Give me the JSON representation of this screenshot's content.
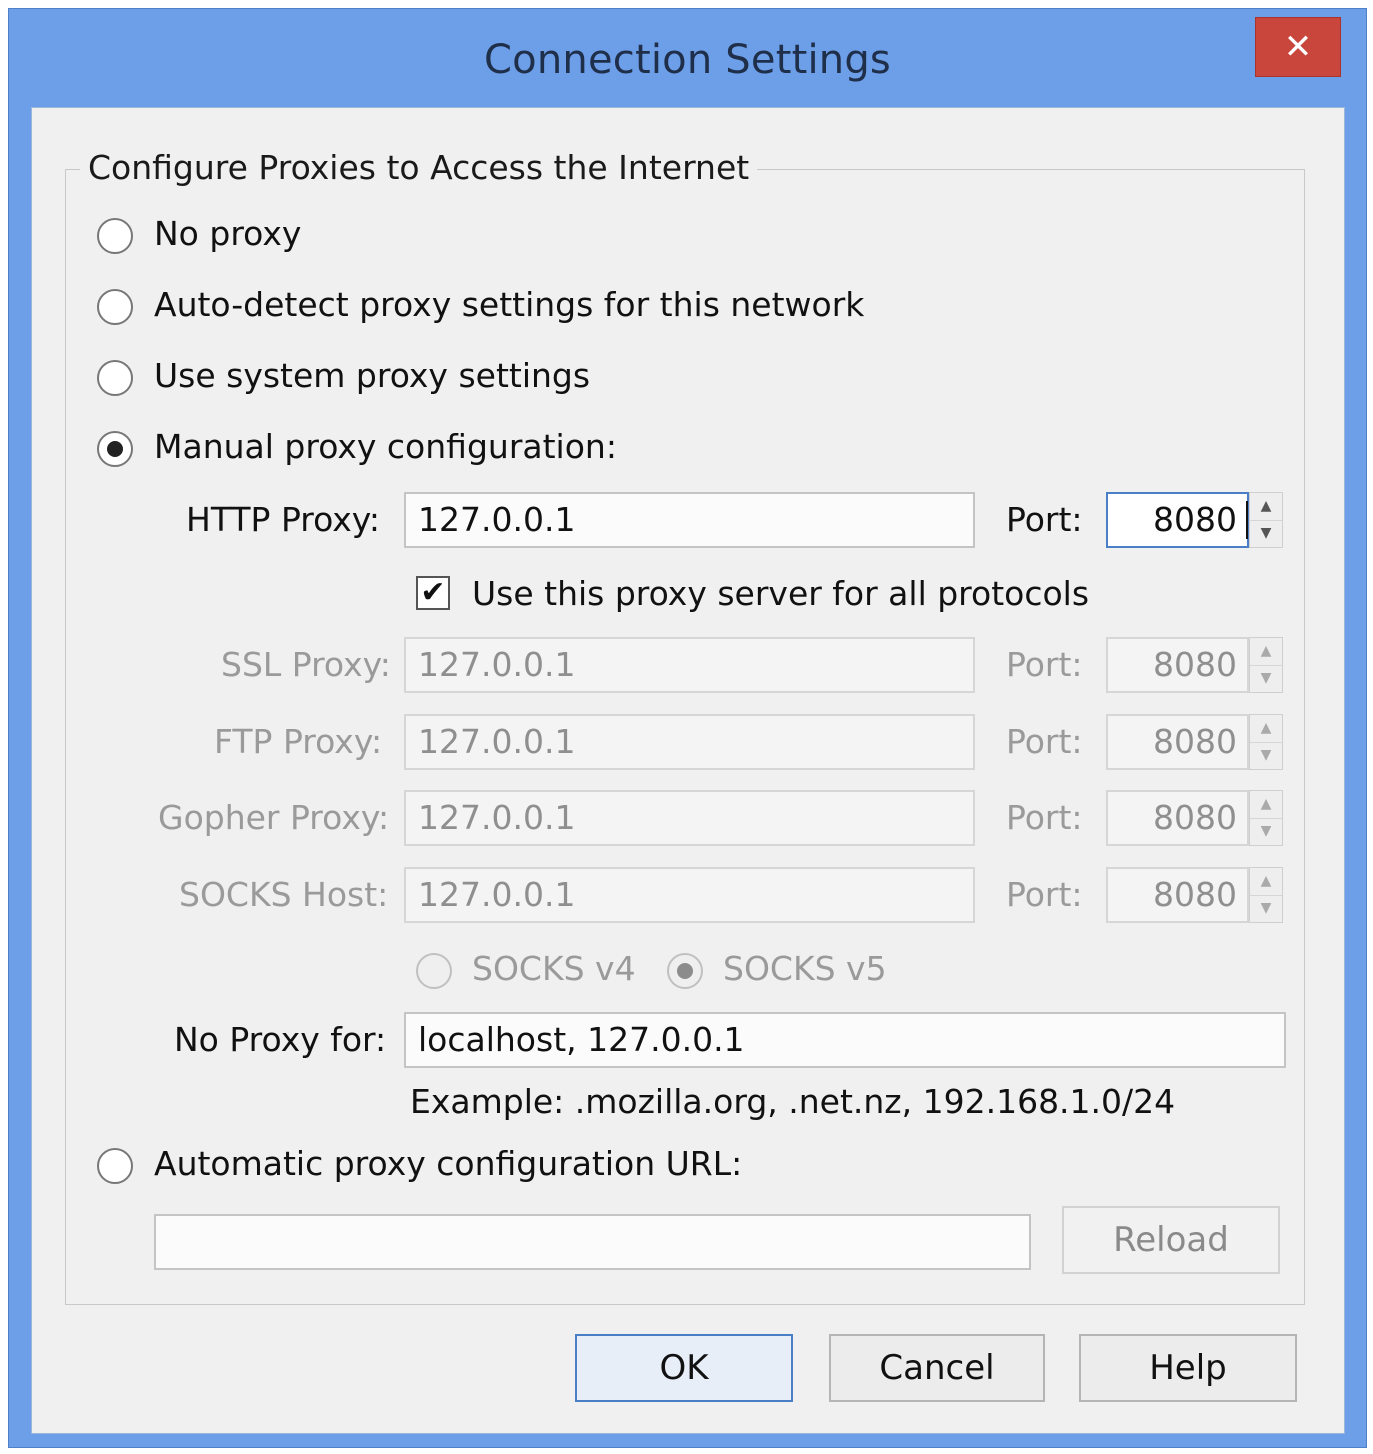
{
  "window": {
    "title": "Connection Settings",
    "close_glyph": "✕"
  },
  "group": {
    "title": "Configure Proxies to Access the Internet"
  },
  "options": {
    "no_proxy": "No proxy",
    "auto_detect": "Auto-detect proxy settings for this network",
    "system": "Use system proxy settings",
    "manual": "Manual proxy configuration:",
    "auto_url": "Automatic proxy configuration URL:"
  },
  "selected_option": "manual",
  "http": {
    "label": "HTTP Proxy:",
    "value": "127.0.0.1",
    "port_label": "Port:",
    "port": "8080"
  },
  "use_all": {
    "label": "Use this proxy server for all protocols",
    "checked": true,
    "check_glyph": "✔"
  },
  "ssl": {
    "label": "SSL Proxy:",
    "value": "127.0.0.1",
    "port_label": "Port:",
    "port": "8080"
  },
  "ftp": {
    "label": "FTP Proxy:",
    "value": "127.0.0.1",
    "port_label": "Port:",
    "port": "8080"
  },
  "gopher": {
    "label": "Gopher Proxy:",
    "value": "127.0.0.1",
    "port_label": "Port:",
    "port": "8080"
  },
  "socks": {
    "label": "SOCKS Host:",
    "value": "127.0.0.1",
    "port_label": "Port:",
    "port": "8080",
    "v4_label": "SOCKS v4",
    "v5_label": "SOCKS v5",
    "selected": "v5"
  },
  "no_proxy_for": {
    "label": "No Proxy for:",
    "value": "localhost, 127.0.0.1",
    "example": "Example: .mozilla.org, .net.nz, 192.168.1.0/24"
  },
  "auto_url": {
    "value": "",
    "reload_label": "Reload"
  },
  "spinner": {
    "up_glyph": "▲",
    "down_glyph": "▼"
  },
  "buttons": {
    "ok": "OK",
    "cancel": "Cancel",
    "help": "Help"
  },
  "colors": {
    "titlebar": "#6d9ee8",
    "close": "#c9463c",
    "client": "#f0f0f0",
    "focus": "#4a7fc7"
  }
}
